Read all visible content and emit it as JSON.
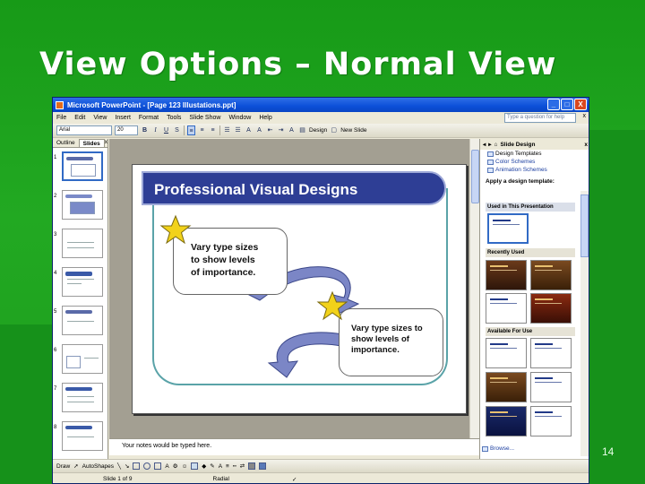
{
  "slide": {
    "title": "View Options – Normal View",
    "number": "14"
  },
  "window": {
    "title": "Microsoft PowerPoint - [Page 123 Illustations.ppt]",
    "buttons": {
      "minimize": "_",
      "maximize": "□",
      "close": "X"
    }
  },
  "menu": {
    "items": [
      "File",
      "Edit",
      "View",
      "Insert",
      "Format",
      "Tools",
      "Slide Show",
      "Window",
      "Help"
    ],
    "help_placeholder": "Type a question for help",
    "close": "x"
  },
  "toolbar": {
    "font": "Arial",
    "size": "20",
    "bold": "B",
    "italic": "I",
    "underline": "U",
    "shadow": "S",
    "design": "Design",
    "new_slide": "New Slide"
  },
  "left_pane": {
    "tabs": [
      "Outline",
      "Slides"
    ],
    "close": "x",
    "slide_numbers": [
      "1",
      "2",
      "3",
      "4",
      "5",
      "6",
      "7",
      "8"
    ]
  },
  "slide_content": {
    "banner": "Professional Visual Designs",
    "callout1": [
      "Vary type sizes",
      "to show levels",
      "of importance."
    ],
    "callout2": [
      "Vary type sizes to",
      "show levels of",
      "importance."
    ]
  },
  "notes": {
    "placeholder": "Your notes would be typed here."
  },
  "task_pane": {
    "title": "Slide Design",
    "links": [
      "Design Templates",
      "Color Schemes",
      "Animation Schemes"
    ],
    "apply_label": "Apply a design template:",
    "sections": [
      "Used in This Presentation",
      "Recently Used",
      "Available For Use"
    ],
    "browse": "Browse..."
  },
  "drawbar": {
    "draw": "Draw",
    "autoshapes": "AutoShapes"
  },
  "status": {
    "slide_of": "Slide 1 of 9",
    "design": "Radial"
  },
  "colors": {
    "background_green": "#1fa01f",
    "banner_blue": "#2e3e95",
    "titlebar_blue": "#0b4fd8",
    "star_yellow": "#f2d21a"
  }
}
